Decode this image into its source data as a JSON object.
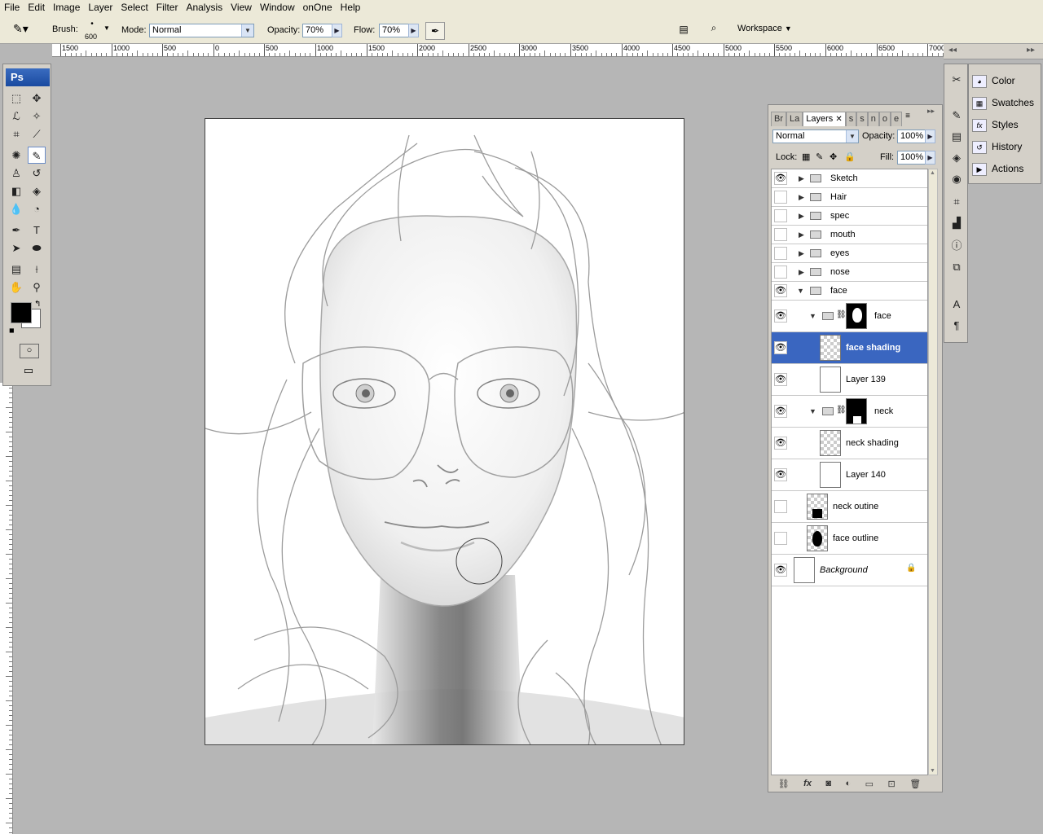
{
  "menu": [
    "File",
    "Edit",
    "Image",
    "Layer",
    "Select",
    "Filter",
    "Analysis",
    "View",
    "Window",
    "onOne",
    "Help"
  ],
  "options": {
    "brush_label": "Brush:",
    "brush_size": "600",
    "mode_label": "Mode:",
    "mode_value": "Normal",
    "opacity_label": "Opacity:",
    "opacity_value": "70%",
    "flow_label": "Flow:",
    "flow_value": "70%",
    "workspace_label": "Workspace"
  },
  "ruler_labels": [
    "1500",
    "1000",
    "500",
    "0",
    "500",
    "1000",
    "1500",
    "2000",
    "2500",
    "3000",
    "3500",
    "4000",
    "4500",
    "5000",
    "5500",
    "6000",
    "6500",
    "7000"
  ],
  "toolbox": {
    "logo": "Ps"
  },
  "layers_panel": {
    "tabs": [
      "Br",
      "La",
      "Layers",
      "s",
      "s",
      "n",
      "o",
      "e"
    ],
    "active_tab": "Layers",
    "blend_mode": "Normal",
    "opacity_label": "Opacity:",
    "opacity_value": "100%",
    "lock_label": "Lock:",
    "fill_label": "Fill:",
    "fill_value": "100%",
    "rows": [
      {
        "name": "Sketch",
        "visible": true,
        "kind": "folder"
      },
      {
        "name": "Hair",
        "visible": false,
        "kind": "folder"
      },
      {
        "name": "spec",
        "visible": false,
        "kind": "folder"
      },
      {
        "name": "mouth",
        "visible": false,
        "kind": "folder"
      },
      {
        "name": "eyes",
        "visible": false,
        "kind": "folder"
      },
      {
        "name": "nose",
        "visible": false,
        "kind": "folder"
      },
      {
        "name": "face",
        "visible": true,
        "kind": "folder-open"
      },
      {
        "name": "face",
        "visible": true,
        "kind": "masked-folder"
      },
      {
        "name": "face shading",
        "visible": true,
        "kind": "layer",
        "selected": true
      },
      {
        "name": "Layer 139",
        "visible": true,
        "kind": "layer"
      },
      {
        "name": "neck",
        "visible": true,
        "kind": "masked-folder"
      },
      {
        "name": "neck shading",
        "visible": true,
        "kind": "layer"
      },
      {
        "name": "Layer 140",
        "visible": true,
        "kind": "layer"
      },
      {
        "name": "neck outine",
        "visible": false,
        "kind": "layer"
      },
      {
        "name": "face outline",
        "visible": false,
        "kind": "layer"
      },
      {
        "name": "Background",
        "visible": true,
        "kind": "background"
      }
    ],
    "bottom_icons": [
      "link-icon",
      "fx-icon",
      "mask-icon",
      "adjustment-icon",
      "folder-icon",
      "new-layer-icon",
      "trash-icon"
    ]
  },
  "dock": {
    "items": [
      "Color",
      "Swatches",
      "Styles",
      "History",
      "Actions"
    ]
  },
  "colors": {
    "selection": "#3a66c0",
    "foreground": "#000000",
    "background": "#ffffff"
  }
}
